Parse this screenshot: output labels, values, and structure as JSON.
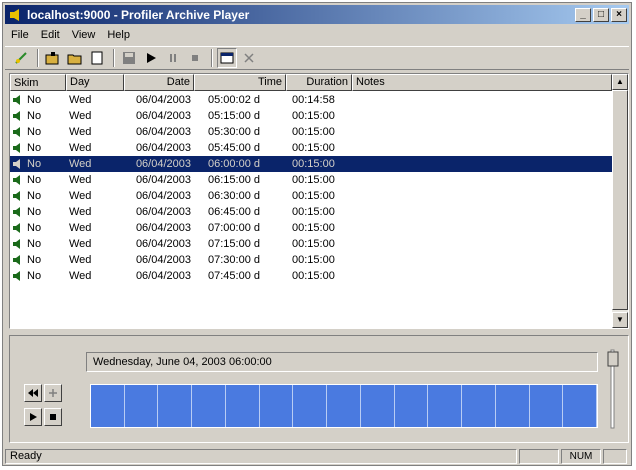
{
  "window": {
    "title": "localhost:9000 - Profiler Archive Player"
  },
  "menu": [
    "File",
    "Edit",
    "View",
    "Help"
  ],
  "toolbar": {
    "icons": [
      "connect-icon",
      "open-folder-icon",
      "open-icon",
      "new-document-icon",
      "save-icon",
      "play-icon",
      "pause-icon",
      "stop-icon",
      "window-icon",
      "close-icon"
    ]
  },
  "table": {
    "headers": {
      "skim": "Skim",
      "day": "Day",
      "date": "Date",
      "time": "Time",
      "duration": "Duration",
      "notes": "Notes"
    },
    "rows": [
      {
        "skim": "No",
        "day": "Wed",
        "date": "06/04/2003",
        "time": "05:00:02 d",
        "duration": "00:14:58",
        "notes": ""
      },
      {
        "skim": "No",
        "day": "Wed",
        "date": "06/04/2003",
        "time": "05:15:00 d",
        "duration": "00:15:00",
        "notes": ""
      },
      {
        "skim": "No",
        "day": "Wed",
        "date": "06/04/2003",
        "time": "05:30:00 d",
        "duration": "00:15:00",
        "notes": ""
      },
      {
        "skim": "No",
        "day": "Wed",
        "date": "06/04/2003",
        "time": "05:45:00 d",
        "duration": "00:15:00",
        "notes": ""
      },
      {
        "skim": "No",
        "day": "Wed",
        "date": "06/04/2003",
        "time": "06:00:00 d",
        "duration": "00:15:00",
        "notes": "",
        "selected": true
      },
      {
        "skim": "No",
        "day": "Wed",
        "date": "06/04/2003",
        "time": "06:15:00 d",
        "duration": "00:15:00",
        "notes": ""
      },
      {
        "skim": "No",
        "day": "Wed",
        "date": "06/04/2003",
        "time": "06:30:00 d",
        "duration": "00:15:00",
        "notes": ""
      },
      {
        "skim": "No",
        "day": "Wed",
        "date": "06/04/2003",
        "time": "06:45:00 d",
        "duration": "00:15:00",
        "notes": ""
      },
      {
        "skim": "No",
        "day": "Wed",
        "date": "06/04/2003",
        "time": "07:00:00 d",
        "duration": "00:15:00",
        "notes": ""
      },
      {
        "skim": "No",
        "day": "Wed",
        "date": "06/04/2003",
        "time": "07:15:00 d",
        "duration": "00:15:00",
        "notes": ""
      },
      {
        "skim": "No",
        "day": "Wed",
        "date": "06/04/2003",
        "time": "07:30:00 d",
        "duration": "00:15:00",
        "notes": ""
      },
      {
        "skim": "No",
        "day": "Wed",
        "date": "06/04/2003",
        "time": "07:45:00 d",
        "duration": "00:15:00",
        "notes": ""
      }
    ]
  },
  "player": {
    "datetime": "Wednesday, June 04, 2003 06:00:00",
    "timeline_segments": 15,
    "colors": {
      "timeline": "#4a7ae0",
      "selection": "#0a246a"
    }
  },
  "status": {
    "text": "Ready",
    "num": "NUM"
  }
}
